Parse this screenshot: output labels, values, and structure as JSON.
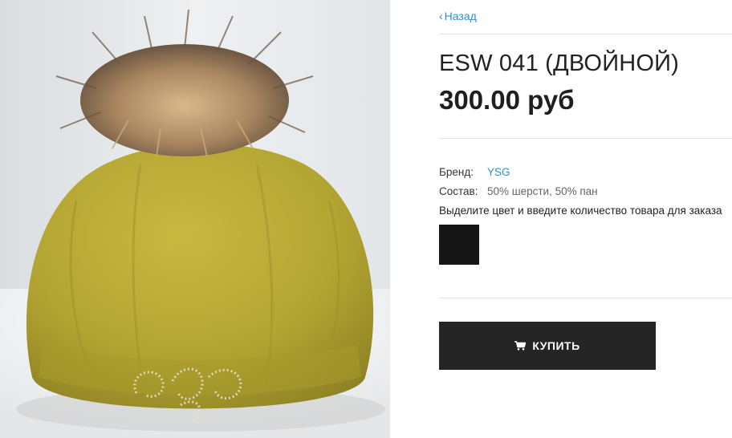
{
  "nav": {
    "back_label": "Назад",
    "back_icon": "chevron-left-icon"
  },
  "product": {
    "title": "ESW 041 (ДВОЙНОЙ)",
    "price": "300.00 руб",
    "specs": {
      "brand_label": "Бренд:",
      "brand_value": "YSG",
      "composition_label": "Состав:",
      "composition_value": "50% шерсти, 50% пан"
    },
    "color_hint": "Выделите цвет и введите количество товара для заказа",
    "colors": [
      {
        "name": "black",
        "hex": "#161616",
        "selected": false
      }
    ]
  },
  "actions": {
    "buy_label": "КУПИТЬ",
    "buy_icon": "cart-icon"
  },
  "theme": {
    "link_color": "#2e8fd6",
    "button_bg": "#252525",
    "hat_color": "#b5a733"
  }
}
